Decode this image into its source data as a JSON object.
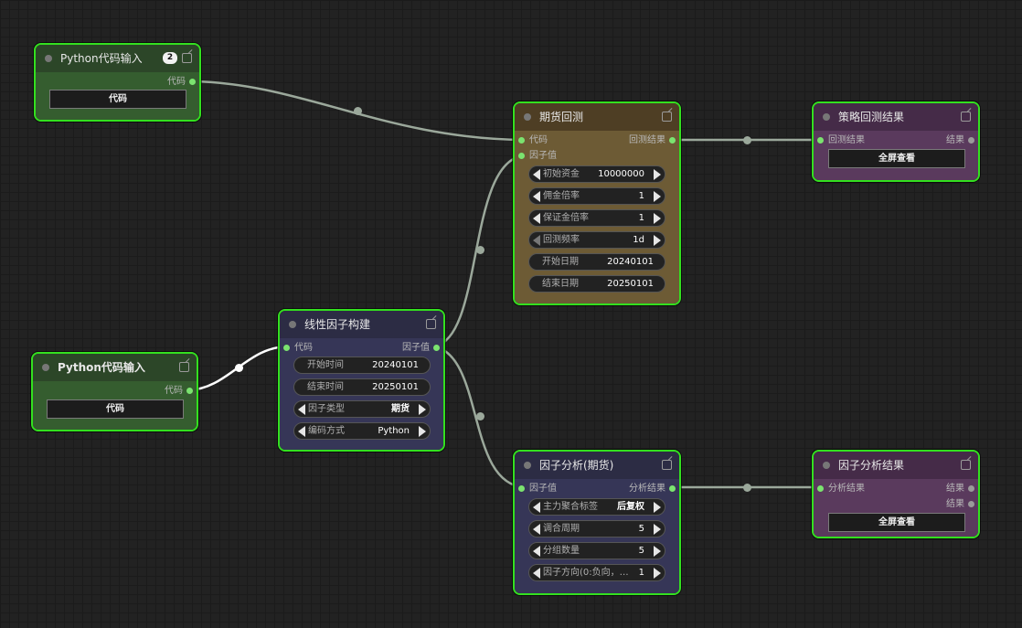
{
  "nodes": {
    "py1": {
      "title": "Python代码输入",
      "badge": "2",
      "output": "代码",
      "button": "代码"
    },
    "py2": {
      "title": "Python代码输入",
      "output": "代码",
      "button": "代码"
    },
    "linear": {
      "title": "线性因子构建",
      "input": "代码",
      "output": "因子值",
      "widgets": [
        {
          "label": "开始时间",
          "value": "20240101"
        },
        {
          "label": "结束时间",
          "value": "20250101"
        },
        {
          "label": "因子类型",
          "value": "期货"
        },
        {
          "label": "编码方式",
          "value": "Python"
        }
      ]
    },
    "backtest": {
      "title": "期货回测",
      "inputs": [
        "代码",
        "因子值"
      ],
      "output": "回测结果",
      "widgets": [
        {
          "label": "初始资金",
          "value": "10000000"
        },
        {
          "label": "佣金倍率",
          "value": "1"
        },
        {
          "label": "保证金倍率",
          "value": "1"
        },
        {
          "label": "回测频率",
          "value": "1d"
        },
        {
          "label": "开始日期",
          "value": "20240101"
        },
        {
          "label": "结束日期",
          "value": "20250101"
        }
      ]
    },
    "strategy_result": {
      "title": "策略回测结果",
      "input": "回测结果",
      "output": "结果",
      "button": "全屏查看"
    },
    "factor_analysis": {
      "title": "因子分析(期货)",
      "input": "因子值",
      "output": "分析结果",
      "widgets": [
        {
          "label": "主力聚合标签",
          "value": "后复权"
        },
        {
          "label": "调合周期",
          "value": "5"
        },
        {
          "label": "分组数量",
          "value": "5"
        },
        {
          "label": "因子方向(0:负向，…",
          "value": "1"
        }
      ]
    },
    "factor_result": {
      "title": "因子分析结果",
      "input": "分析结果",
      "outputs": [
        "结果",
        "结果"
      ],
      "button": "全屏查看"
    }
  },
  "colors": {
    "canvas": "#222222",
    "selection_border": "#33e01f",
    "green_node": "#355d2f",
    "brown_node": "#6d5b35",
    "purple_node": "#5a3a5d",
    "blue_node": "#363657",
    "link": "#9ba89b"
  }
}
